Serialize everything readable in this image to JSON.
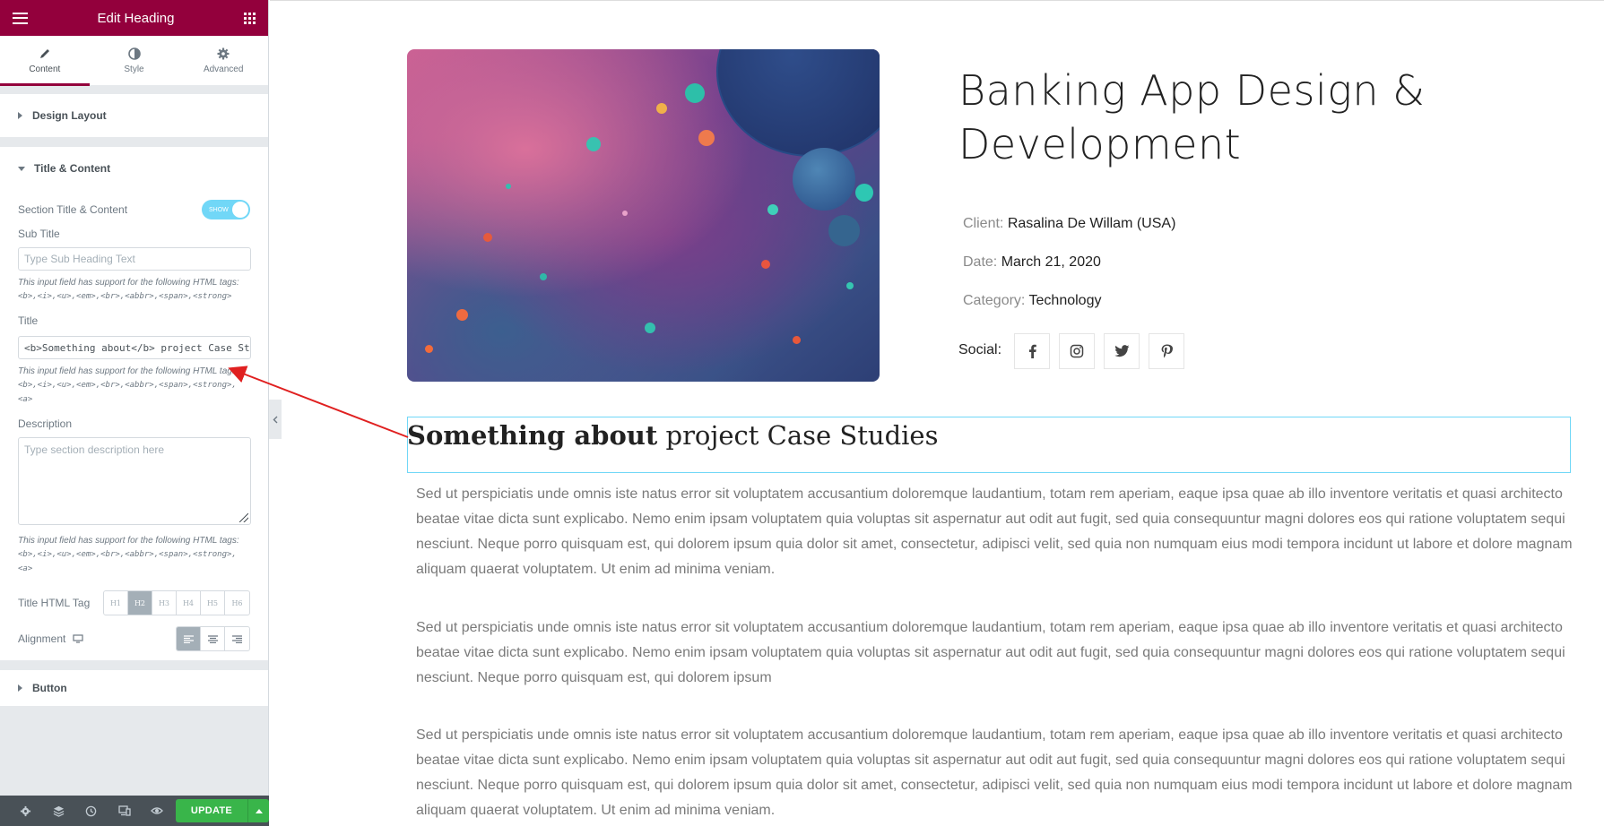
{
  "editor": {
    "title": "Edit Heading",
    "tabs": [
      {
        "label": "Content"
      },
      {
        "label": "Style"
      },
      {
        "label": "Advanced"
      }
    ],
    "sections": {
      "design_layout": "Design Layout",
      "title_content": "Title & Content",
      "button": "Button"
    },
    "controls": {
      "section_toggle_label": "Section Title & Content",
      "section_toggle_value": "SHOW",
      "subtitle_label": "Sub Title",
      "subtitle_placeholder": "Type Sub Heading Text",
      "help_prefix": "This input field has support for the following HTML tags:",
      "subtitle_tags": "<b>,<i>,<u>,<em>,<br>,<abbr>,<span>,<strong>",
      "title_label": "Title",
      "title_value": "<b>Something about</b> project  Case Stu",
      "title_tags": "<b>,<i>,<u>,<em>,<br>,<abbr>,<span>,<strong>,<a>",
      "description_label": "Description",
      "description_placeholder": "Type section description here",
      "description_tags": "<b>,<i>,<u>,<em>,<br>,<abbr>,<span>,<strong>,<a>",
      "html_tag_label": "Title HTML Tag",
      "html_tags": [
        "H1",
        "H2",
        "H3",
        "H4",
        "H5",
        "H6"
      ],
      "html_tag_selected": "H2",
      "alignment_label": "Alignment",
      "alignment_selected": "left"
    },
    "footer": {
      "update_label": "UPDATE"
    }
  },
  "page": {
    "project_title": "Banking App Design & Development",
    "meta": [
      {
        "key": "Client:",
        "value": "Rasalina De Willam (USA)"
      },
      {
        "key": "Date:",
        "value": "March 21, 2020"
      },
      {
        "key": "Category:",
        "value": "Technology"
      }
    ],
    "social_label": "Social:",
    "social_icons": [
      "facebook-icon",
      "instagram-icon",
      "twitter-icon",
      "pinterest-icon"
    ],
    "heading_bold": "Something about",
    "heading_rest": " project Case Studies",
    "paragraphs": [
      "Sed ut perspiciatis unde omnis iste natus error sit voluptatem accusantium doloremque laudantium, totam rem aperiam, eaque ipsa quae ab illo inventore veritatis et quasi architecto beatae vitae dicta sunt explicabo. Nemo enim ipsam voluptatem quia voluptas sit aspernatur aut odit aut fugit, sed quia consequuntur magni dolores eos qui ratione voluptatem sequi nesciunt. Neque porro quisquam est, qui dolorem ipsum quia dolor sit amet, consectetur, adipisci velit, sed quia non numquam eius modi tempora incidunt ut labore et dolore magnam aliquam quaerat voluptatem. Ut enim ad minima veniam.",
      "Sed ut perspiciatis unde omnis iste natus error sit voluptatem accusantium doloremque laudantium, totam rem aperiam, eaque ipsa quae ab illo inventore veritatis et quasi architecto beatae vitae dicta sunt explicabo. Nemo enim ipsam voluptatem quia voluptas sit aspernatur aut odit aut fugit, sed quia consequuntur magni dolores eos qui ratione voluptatem sequi nesciunt. Neque porro quisquam est, qui dolorem ipsum",
      "Sed ut perspiciatis unde omnis iste natus error sit voluptatem accusantium doloremque laudantium, totam rem aperiam, eaque ipsa quae ab illo inventore veritatis et quasi architecto beatae vitae dicta sunt explicabo. Nemo enim ipsam voluptatem quia voluptas sit aspernatur aut odit aut fugit, sed quia consequuntur magni dolores eos qui ratione voluptatem sequi nesciunt. Neque porro quisquam est, qui dolorem ipsum quia dolor sit amet, consectetur, adipisci velit, sed quia non numquam eius modi tempora incidunt ut labore et dolore magnam aliquam quaerat voluptatem. Ut enim ad minima veniam."
    ]
  },
  "colors": {
    "brand": "#93003c",
    "update_green": "#39b54a",
    "toggle_on": "#71d7f7",
    "annotation_arrow": "#e02020"
  }
}
